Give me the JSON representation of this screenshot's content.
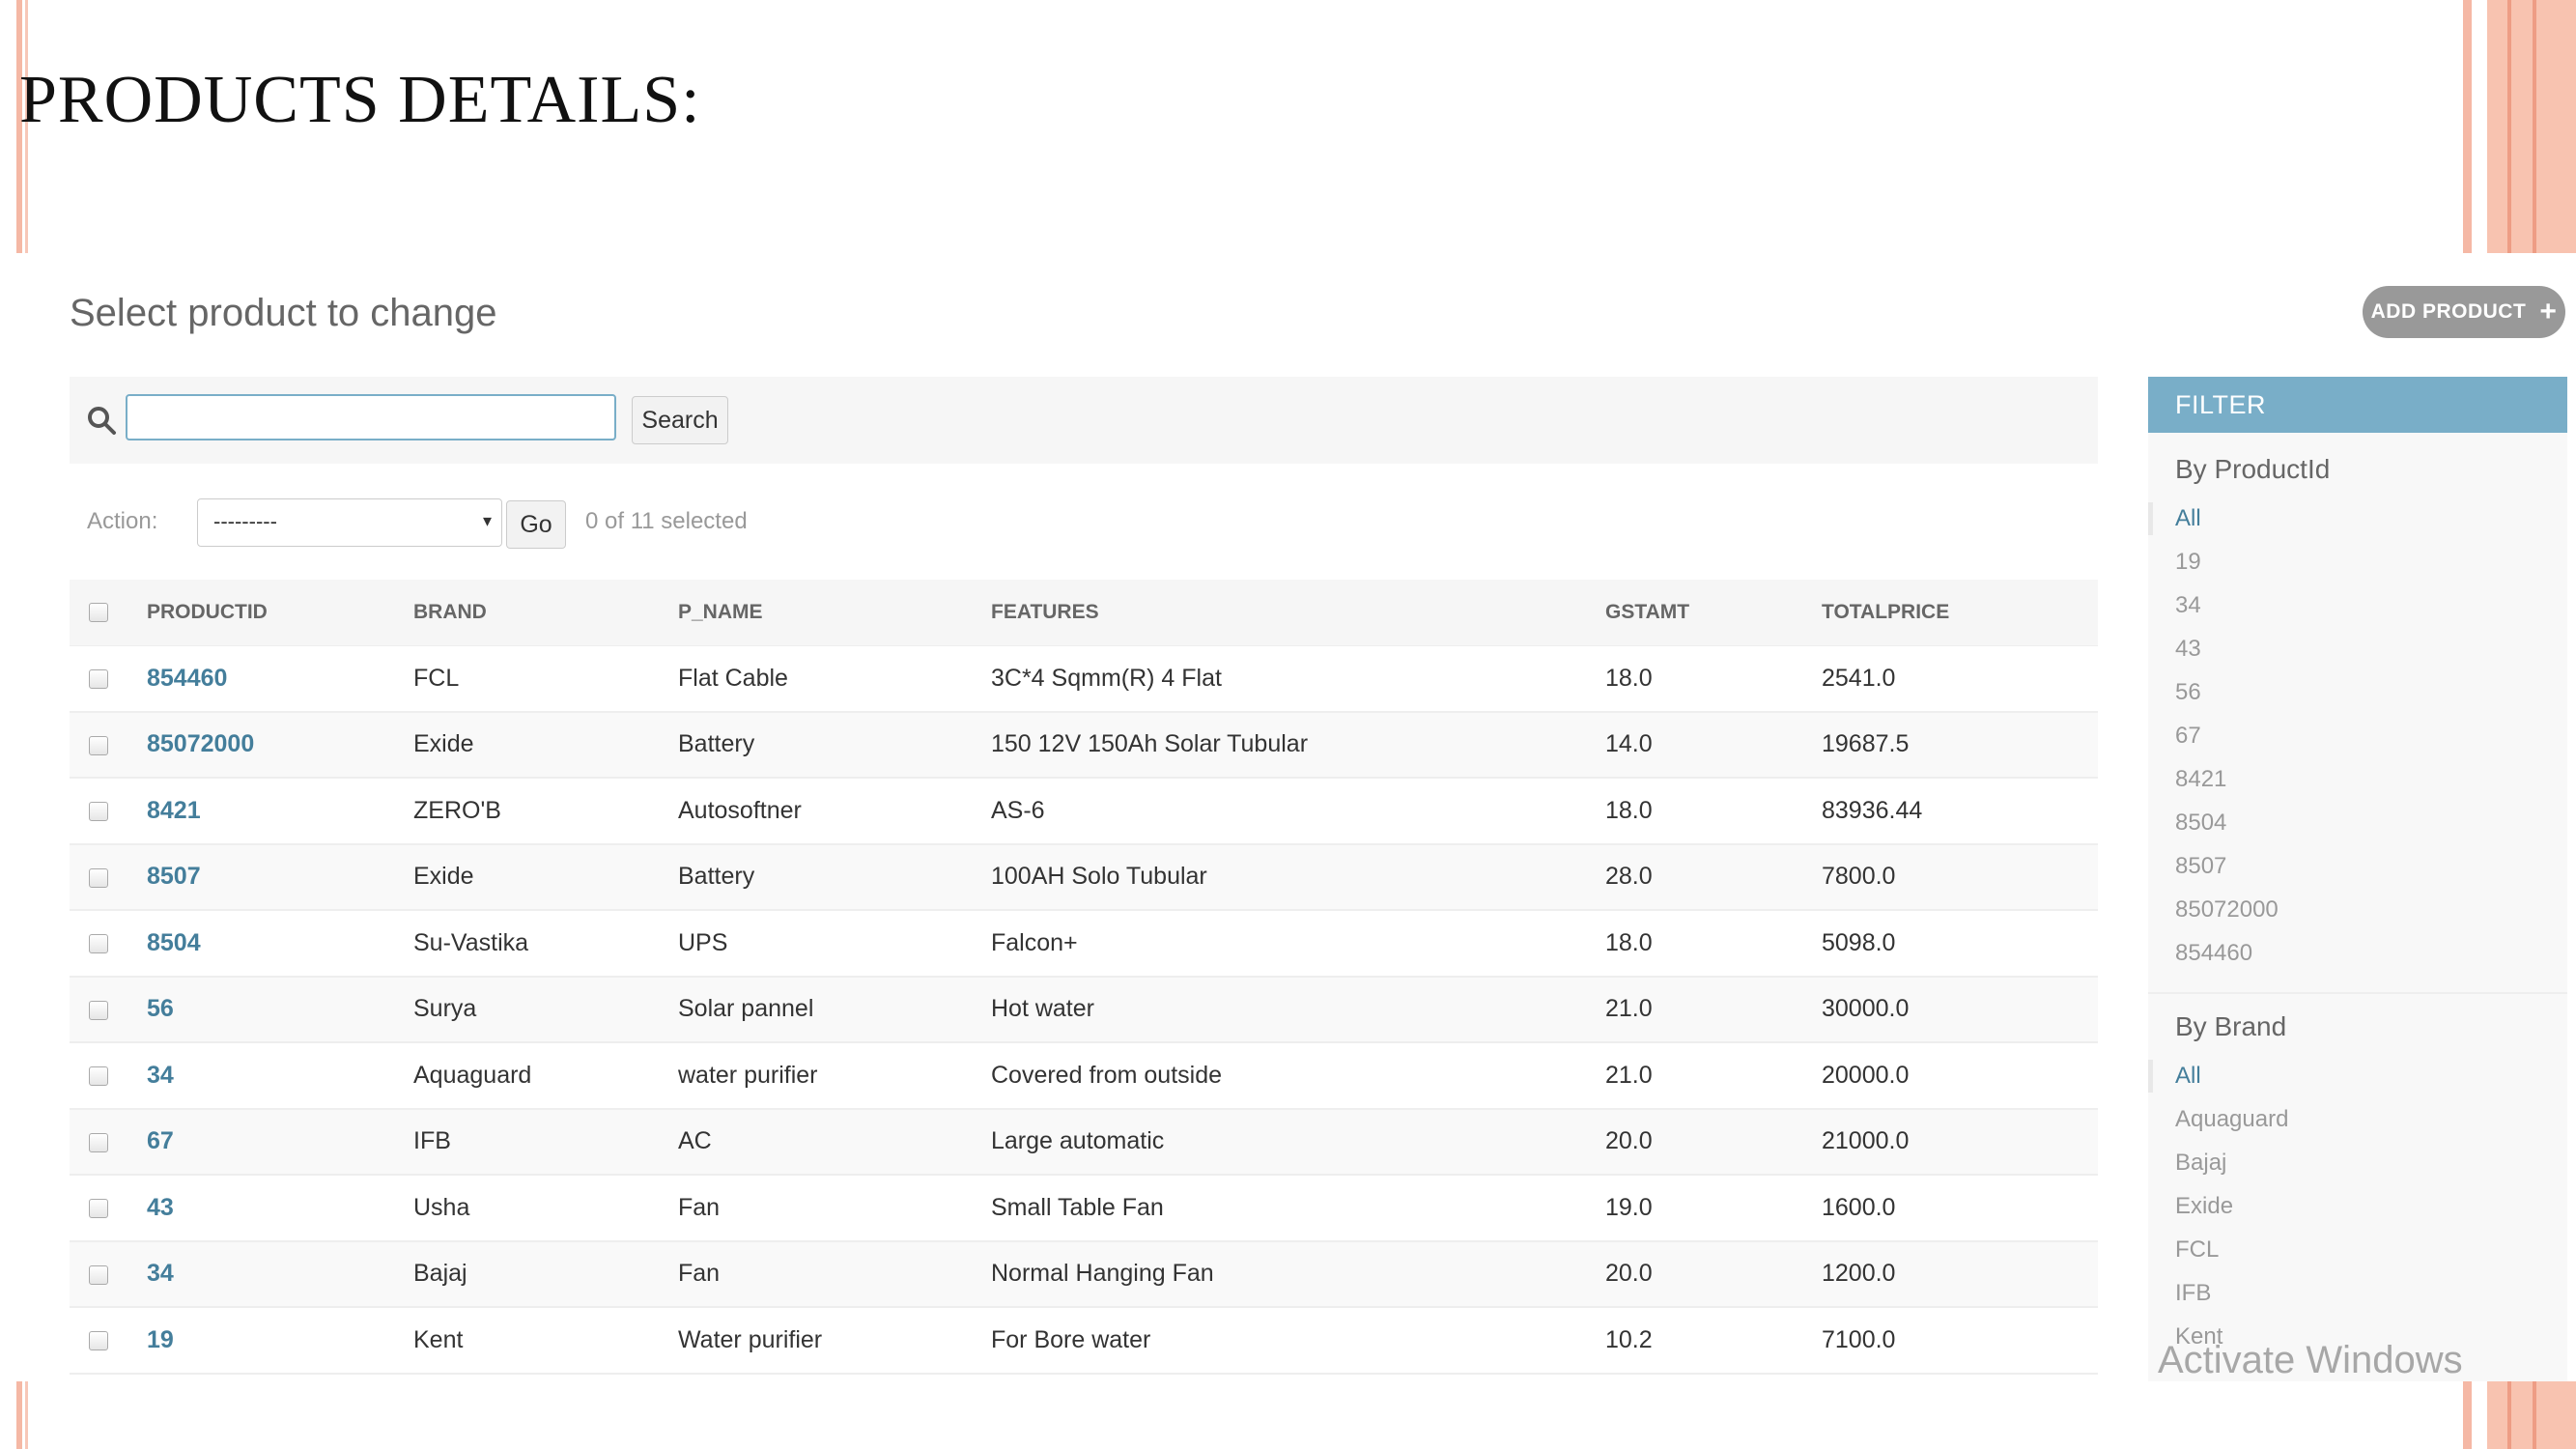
{
  "slide": {
    "title": "PRODUCTS DETAILS:"
  },
  "header": {
    "heading": "Select product to change",
    "add_button_label": "ADD PRODUCT",
    "add_button_icon": "plus-icon"
  },
  "search": {
    "value": "",
    "placeholder": "",
    "button_label": "Search"
  },
  "actions": {
    "label": "Action:",
    "selected_option": "---------",
    "go_label": "Go",
    "selected_count": "0 of 11 selected"
  },
  "table": {
    "columns": [
      "PRODUCTID",
      "BRAND",
      "P_NAME",
      "FEATURES",
      "GSTAMT",
      "TOTALPRICE"
    ],
    "rows": [
      {
        "id": "854460",
        "brand": "FCL",
        "name": "Flat Cable",
        "features": "3C*4 Sqmm(R) 4 Flat",
        "gst": "18.0",
        "total": "2541.0"
      },
      {
        "id": "85072000",
        "brand": "Exide",
        "name": "Battery",
        "features": "150 12V 150Ah Solar Tubular",
        "gst": "14.0",
        "total": "19687.5"
      },
      {
        "id": "8421",
        "brand": "ZERO'B",
        "name": "Autosoftner",
        "features": "AS-6",
        "gst": "18.0",
        "total": "83936.44"
      },
      {
        "id": "8507",
        "brand": "Exide",
        "name": "Battery",
        "features": "100AH Solo Tubular",
        "gst": "28.0",
        "total": "7800.0"
      },
      {
        "id": "8504",
        "brand": "Su-Vastika",
        "name": "UPS",
        "features": "Falcon+",
        "gst": "18.0",
        "total": "5098.0"
      },
      {
        "id": "56",
        "brand": "Surya",
        "name": "Solar pannel",
        "features": "Hot water",
        "gst": "21.0",
        "total": "30000.0"
      },
      {
        "id": "34",
        "brand": "Aquaguard",
        "name": "water purifier",
        "features": "Covered from outside",
        "gst": "21.0",
        "total": "20000.0"
      },
      {
        "id": "67",
        "brand": "IFB",
        "name": "AC",
        "features": "Large automatic",
        "gst": "20.0",
        "total": "21000.0"
      },
      {
        "id": "43",
        "brand": "Usha",
        "name": "Fan",
        "features": "Small Table Fan",
        "gst": "19.0",
        "total": "1600.0"
      },
      {
        "id": "34",
        "brand": "Bajaj",
        "name": "Fan",
        "features": "Normal Hanging Fan",
        "gst": "20.0",
        "total": "1200.0"
      },
      {
        "id": "19",
        "brand": "Kent",
        "name": "Water purifier",
        "features": "For Bore water",
        "gst": "10.2",
        "total": "7100.0"
      }
    ]
  },
  "filter": {
    "title": "FILTER",
    "by_product_id": {
      "title": "By ProductId",
      "items": [
        "All",
        "19",
        "34",
        "43",
        "56",
        "67",
        "8421",
        "8504",
        "8507",
        "85072000",
        "854460"
      ]
    },
    "by_brand": {
      "title": "By Brand",
      "items": [
        "All",
        "Aquaguard",
        "Bajaj",
        "Exide",
        "FCL",
        "IFB",
        "Kent"
      ]
    }
  },
  "watermark": "Activate Windows",
  "colors": {
    "link": "#447e9b",
    "filter_header": "#79aec8",
    "slide_accent": "#f5b8a5"
  }
}
